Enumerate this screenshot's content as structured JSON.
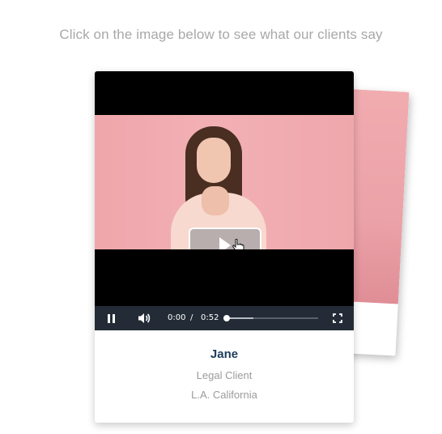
{
  "instruction": "Click on the image below to see what our clients say",
  "video": {
    "current_time": "0:00",
    "separator": "/",
    "duration": "0:52",
    "played_fraction": 0.0,
    "buffered_fraction": 0.3
  },
  "testimonial": {
    "name": "Jane",
    "role": "Legal Client",
    "location": "L.A. California"
  },
  "colors": {
    "name_text": "#1d3d5c",
    "controls_bg": "#232c36",
    "photo_bg": "#f2b0b5"
  },
  "icons": {
    "play": "play-icon",
    "pause": "pause-icon",
    "volume": "volume-icon",
    "fullscreen": "fullscreen-icon",
    "cursor": "hand-cursor-icon"
  }
}
